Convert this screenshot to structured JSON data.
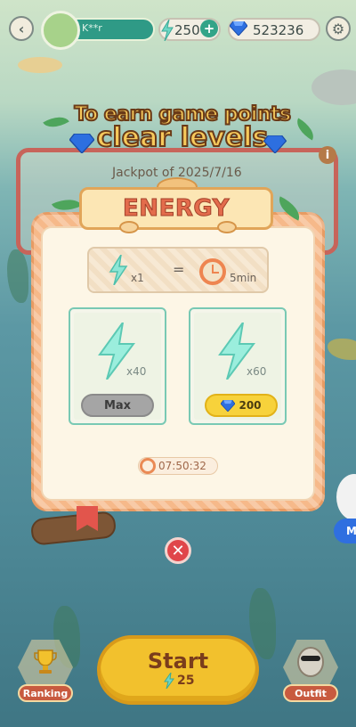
{
  "topbar": {
    "player_name": "K**r",
    "energy_count": "250",
    "gem_count": "523236"
  },
  "banner": {
    "title_line1": "To earn game points",
    "title_line2": "clear levels",
    "jackpot_text": "Jackpot of 2025/7/16"
  },
  "modal": {
    "title": "ENERGY",
    "rate": {
      "energy_qty": "x1",
      "equals": "=",
      "time": "5min"
    },
    "options": [
      {
        "qty": "x40",
        "button_label": "Max"
      },
      {
        "qty": "x60",
        "button_label": "200"
      }
    ],
    "timer": "07:50:32"
  },
  "side_badge": "M",
  "bottom": {
    "ranking_label": "Ranking",
    "start_label": "Start",
    "start_cost": "25",
    "outfit_label": "Outfit"
  },
  "colors": {
    "accent_teal": "#2f9a86",
    "energy_bolt": "#6fd6c5",
    "start_yellow": "#f2c12d",
    "close_red": "#e0464a"
  }
}
